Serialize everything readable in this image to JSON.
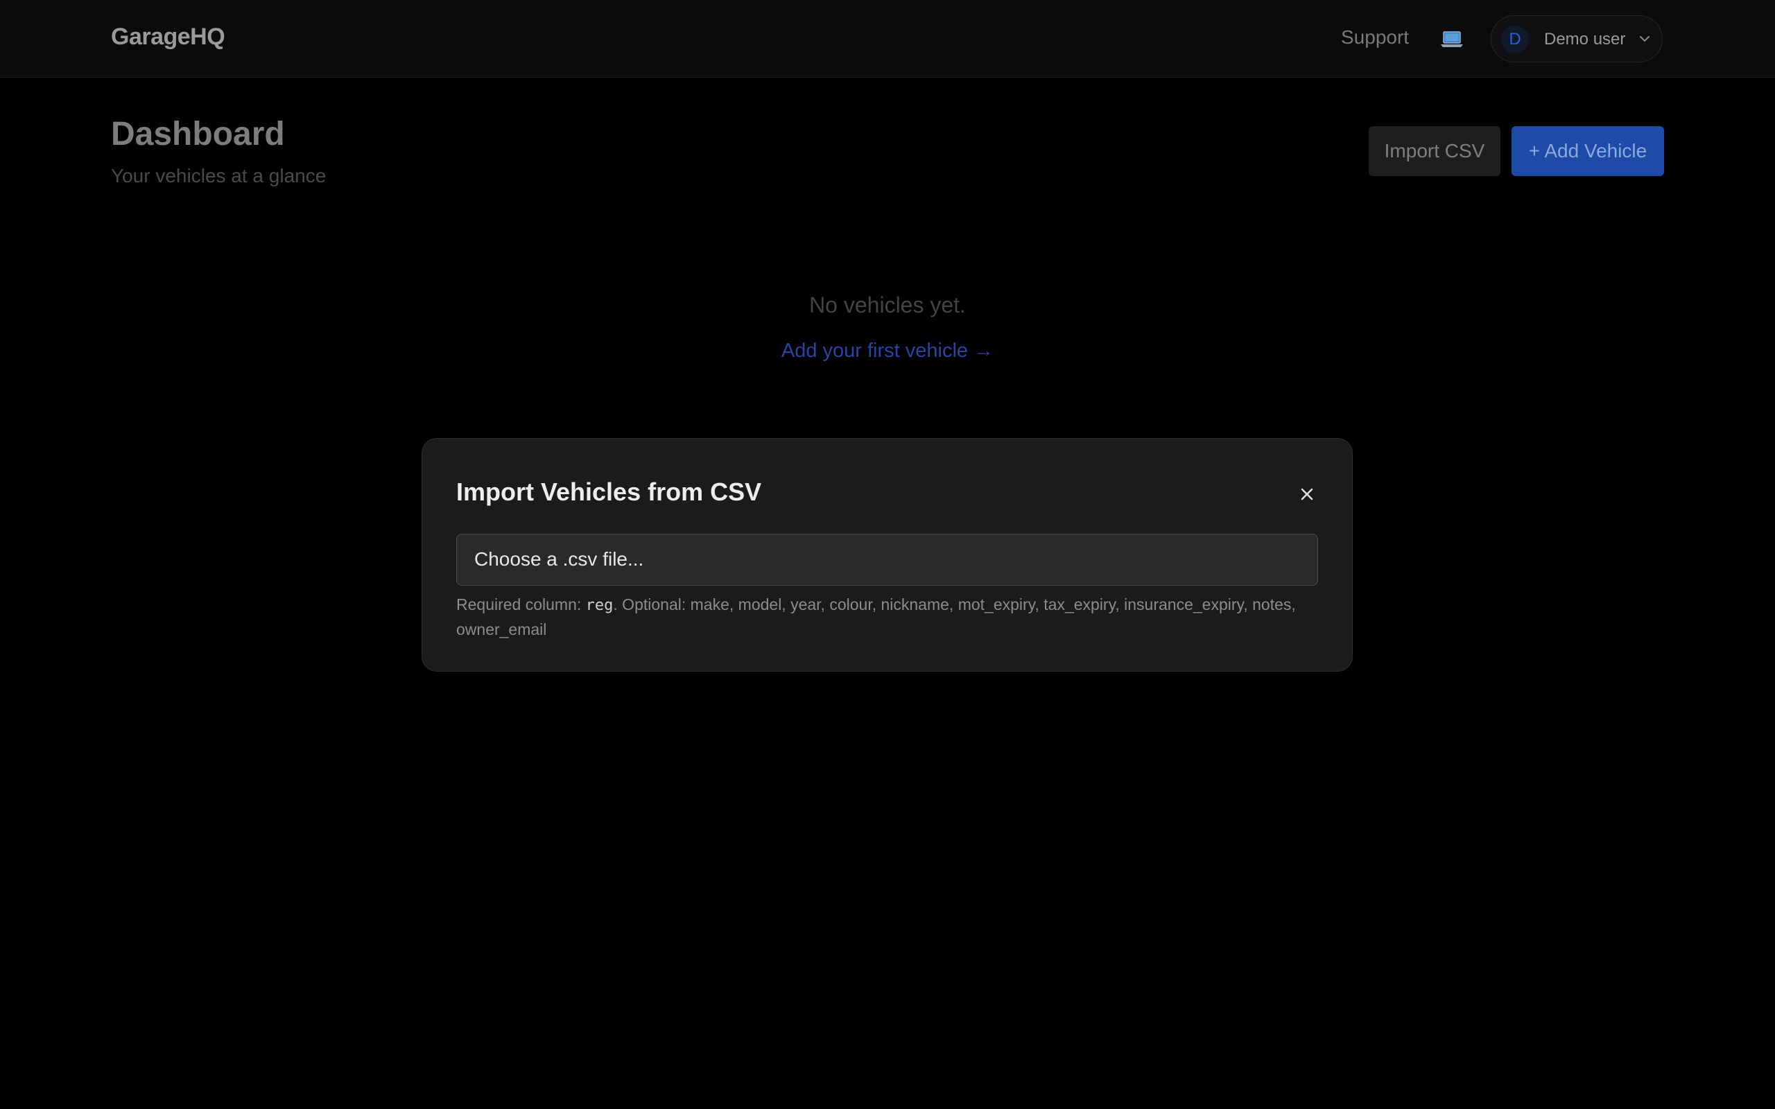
{
  "header": {
    "brand": "GarageHQ",
    "support_label": "Support",
    "theme_icon": "laptop-icon",
    "user": {
      "avatar_initial": "D",
      "name": "Demo user",
      "chevron_icon": "chevron-down-icon"
    }
  },
  "page": {
    "title": "Dashboard",
    "subtitle": "Your vehicles at a glance",
    "import_label": "Import CSV",
    "add_label": "+ Add Vehicle"
  },
  "empty_state": {
    "message": "No vehicles yet.",
    "link": "Add your first vehicle →"
  },
  "modal": {
    "title": "Import Vehicles from CSV",
    "close_icon": "close-icon",
    "file_placeholder": "Choose a .csv file...",
    "hint_prefix": "Required column: ",
    "hint_required": "reg",
    "hint_suffix": ". Optional: make, model, year, colour, nickname, mot_expiry, tax_expiry, insurance_expiry, notes, owner_email"
  },
  "colors": {
    "background": "#000000",
    "header_bg": "#0b0b0c",
    "modal_bg": "#1b1b1d",
    "accent": "#1e4aa8",
    "link": "#2446a2"
  }
}
